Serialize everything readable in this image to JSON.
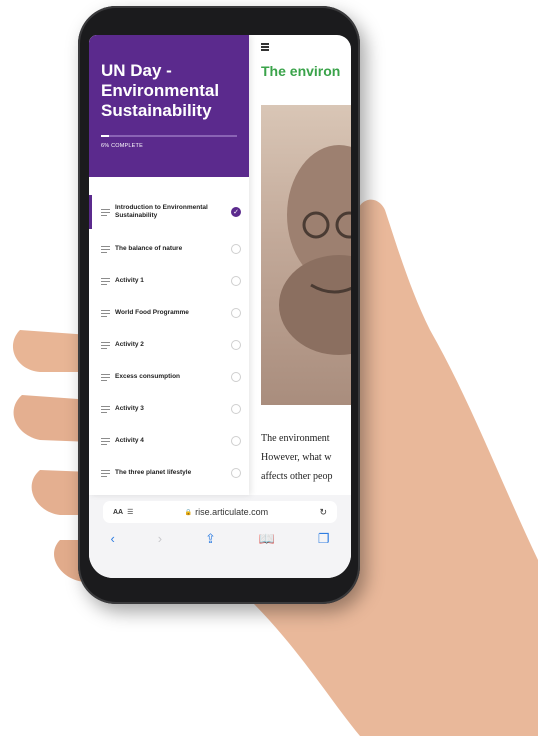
{
  "course": {
    "title": "UN Day - Environmental Sustainability",
    "progress_label": "6% COMPLETE",
    "progress": 0.06
  },
  "lessons": [
    {
      "label": "Introduction to Environmental Sustainability",
      "complete": true
    },
    {
      "label": "The balance of nature",
      "complete": false
    },
    {
      "label": "Activity 1",
      "complete": false
    },
    {
      "label": "World Food Programme",
      "complete": false
    },
    {
      "label": "Activity 2",
      "complete": false
    },
    {
      "label": "Excess consumption",
      "complete": false
    },
    {
      "label": "Activity 3",
      "complete": false
    },
    {
      "label": "Activity 4",
      "complete": false
    },
    {
      "label": "The three planet lifestyle",
      "complete": false
    }
  ],
  "content": {
    "heading": "The environ",
    "body_lines": [
      "The environment",
      "However, what w",
      "affects other peop"
    ]
  },
  "browser": {
    "text_size_label": "AA",
    "url": "rise.articulate.com"
  },
  "icons": {
    "menu": "hamburger-icon",
    "reader": "reader-view-icon",
    "lock": "lock-icon",
    "reload": "reload-icon",
    "back": "chevron-left-icon",
    "forward": "chevron-right-icon",
    "share": "share-icon",
    "bookmarks": "book-icon",
    "tabs": "tabs-icon"
  },
  "colors": {
    "brand": "#5b2a8d",
    "heading": "#3aa34a",
    "link": "#2f7de1"
  }
}
